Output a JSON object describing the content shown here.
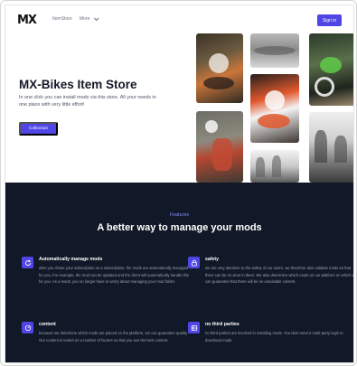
{
  "header": {
    "logo": "MX",
    "nav": [
      {
        "label": "ItemStore"
      },
      {
        "label": "More"
      }
    ],
    "signin_label": "Sign in"
  },
  "hero": {
    "title": "MX-Bikes Item Store",
    "subtitle": "In one click you can install mods via this store. All your needs in one place with very little effort!",
    "button_label": "Collection"
  },
  "features": {
    "eyebrow": "Features",
    "title": "A better way to manage your mods",
    "items": [
      {
        "icon": "refresh-icon",
        "title": "Automatically manage mods",
        "description": "after you chose your subscription on a subscription, the mods are automatically managed for you. For example, the mod can be updated and the client will automatically handle this for you. As a result, you no longer have to worry about managing your mod folder."
      },
      {
        "icon": "lock-icon",
        "title": "safety",
        "description": "we are very attentive to the safety of our users, we therefore also validate mods so that there can be no virus in them. We also determine which mods on our platform on which we can guarantee that there will be no unsuitable content."
      },
      {
        "icon": "gauge-icon",
        "title": "content",
        "description": "because we determine which mods are placed on the platform, we can guarantee quality. Our content is tested on a number of factors so that you see the best content."
      },
      {
        "icon": "server-icon",
        "title": "no third parties",
        "description": "no third parties are involved in installing mods. You dont need a multi-party login to download mods."
      }
    ]
  },
  "colors": {
    "accent": "#4f46e5",
    "dark_section": "#111827",
    "eyebrow": "#818cf8"
  }
}
